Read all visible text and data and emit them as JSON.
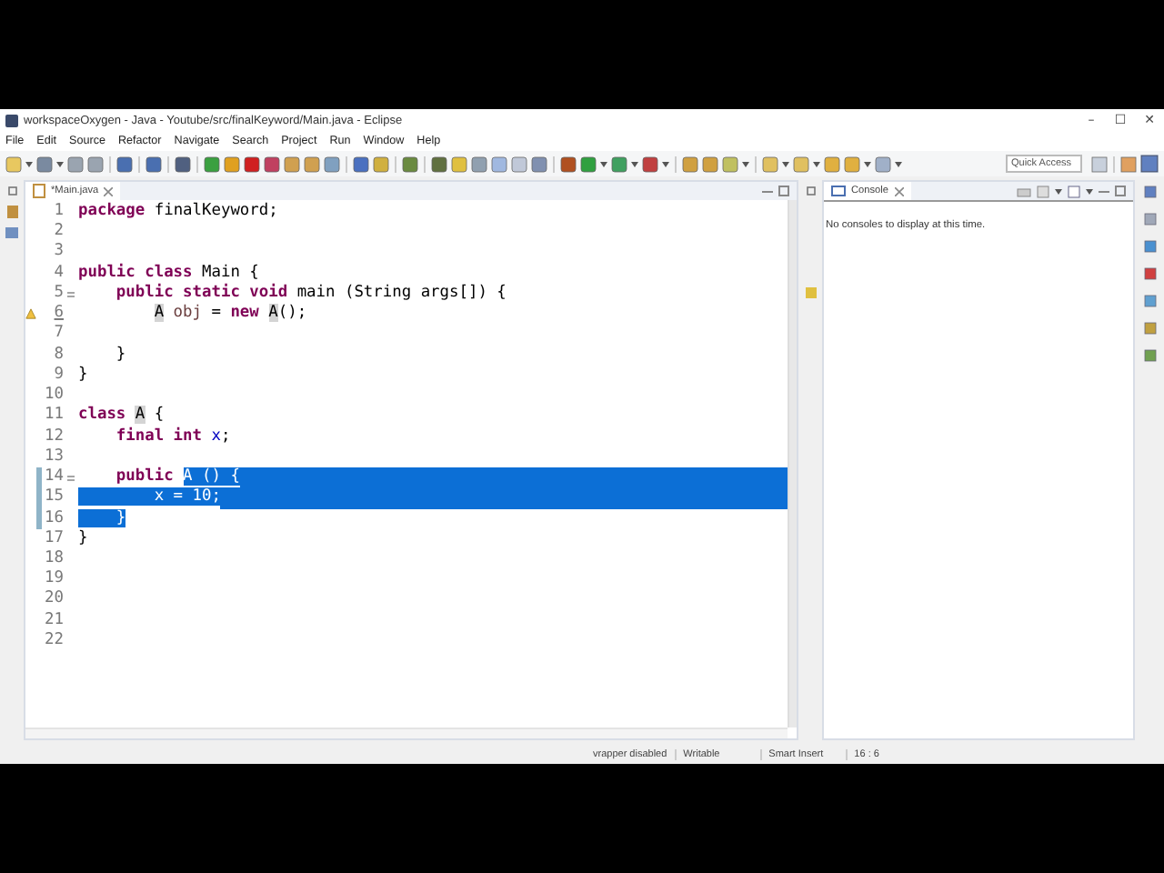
{
  "window": {
    "title": "workspaceOxygen - Java - Youtube/src/finalKeyword/Main.java - Eclipse",
    "controls": [
      "–",
      "☐",
      "✕"
    ]
  },
  "menu": [
    "File",
    "Edit",
    "Source",
    "Refactor",
    "Navigate",
    "Search",
    "Project",
    "Run",
    "Window",
    "Help"
  ],
  "quick_access": {
    "placeholder": "Quick Access"
  },
  "editor": {
    "tab": {
      "label": "*Main.java",
      "selected": true
    },
    "lines": [
      {
        "number": "1",
        "fold": false,
        "warning": false,
        "in_selection": false,
        "selected_to_end": false,
        "segments": [
          {
            "text": "package",
            "kind": "keyword",
            "selected": false
          },
          {
            "text": " finalKeyword;",
            "kind": "plain",
            "selected": false
          }
        ]
      },
      {
        "number": "2",
        "fold": false,
        "warning": false,
        "in_selection": false,
        "selected_to_end": false
      },
      {
        "number": "3",
        "fold": false,
        "warning": false,
        "in_selection": false,
        "selected_to_end": false
      },
      {
        "number": "4",
        "fold": false,
        "warning": false,
        "in_selection": false,
        "selected_to_end": false,
        "segments": [
          {
            "text": "public",
            "kind": "keyword",
            "selected": false
          },
          {
            "text": " class",
            "kind": "keyword",
            "selected": false
          },
          {
            "text": " Main {",
            "kind": "plain",
            "selected": false
          }
        ]
      },
      {
        "number": "5",
        "fold": true,
        "warning": false,
        "in_selection": false,
        "selected_to_end": false,
        "segments": [
          {
            "text": "    public",
            "kind": "keyword",
            "selected": false
          },
          {
            "text": " static",
            "kind": "keyword",
            "selected": false
          },
          {
            "text": " void",
            "kind": "keyword",
            "selected": false
          },
          {
            "text": " main (String args[]) {",
            "kind": "plain",
            "selected": false
          }
        ]
      },
      {
        "number": "6",
        "fold": false,
        "warning": true,
        "in_selection": false,
        "selected_to_end": false,
        "segments": [
          {
            "text": "        A",
            "kind": "occurrence",
            "selected": false
          },
          {
            "text": " obj",
            "kind": "local",
            "selected": false
          },
          {
            "text": " =",
            "kind": "plain",
            "selected": false
          },
          {
            "text": " new",
            "kind": "keyword",
            "selected": false
          },
          {
            "text": " A",
            "kind": "occurrence",
            "selected": false
          },
          {
            "text": "();",
            "kind": "plain",
            "selected": false
          }
        ]
      },
      {
        "number": "7",
        "fold": false,
        "warning": false,
        "in_selection": false,
        "selected_to_end": false
      },
      {
        "number": "8",
        "fold": false,
        "warning": false,
        "in_selection": false,
        "selected_to_end": false,
        "segments": [
          {
            "text": "    }",
            "kind": "plain",
            "selected": false
          }
        ]
      },
      {
        "number": "9",
        "fold": false,
        "warning": false,
        "in_selection": false,
        "selected_to_end": false,
        "segments": [
          {
            "text": "}",
            "kind": "plain",
            "selected": false
          }
        ]
      },
      {
        "number": "10",
        "fold": false,
        "warning": false,
        "in_selection": false,
        "selected_to_end": false
      },
      {
        "number": "11",
        "fold": false,
        "warning": false,
        "in_selection": false,
        "selected_to_end": false,
        "segments": [
          {
            "text": "class",
            "kind": "keyword",
            "selected": false
          },
          {
            "text": " A",
            "kind": "occurrence",
            "selected": false
          },
          {
            "text": " {",
            "kind": "plain",
            "selected": false
          }
        ]
      },
      {
        "number": "12",
        "fold": false,
        "warning": false,
        "in_selection": false,
        "selected_to_end": false,
        "segments": [
          {
            "text": "    final",
            "kind": "keyword",
            "selected": false
          },
          {
            "text": " int",
            "kind": "keyword",
            "selected": false
          },
          {
            "text": " x",
            "kind": "field",
            "selected": false
          },
          {
            "text": ";",
            "kind": "plain",
            "selected": false
          }
        ]
      },
      {
        "number": "13",
        "fold": false,
        "warning": false,
        "in_selection": false,
        "selected_to_end": false
      },
      {
        "number": "14",
        "fold": true,
        "warning": false,
        "in_selection": true,
        "selected_to_end": true,
        "segments": [
          {
            "text": "    public ",
            "kind": "keyword",
            "selected": false
          },
          {
            "text": "A () {",
            "kind": "plain",
            "selected": true
          }
        ]
      },
      {
        "number": "15",
        "fold": false,
        "warning": false,
        "in_selection": true,
        "selected_to_end": true,
        "segments": [
          {
            "text": "        x = 10;",
            "kind": "plain",
            "selected": true
          }
        ]
      },
      {
        "number": "16",
        "fold": false,
        "warning": false,
        "in_selection": true,
        "selected_to_end": false,
        "segments": [
          {
            "text": "    }",
            "kind": "plain",
            "selected": true
          }
        ]
      },
      {
        "number": "17",
        "fold": false,
        "warning": false,
        "in_selection": false,
        "selected_to_end": false,
        "segments": [
          {
            "text": "}",
            "kind": "plain",
            "selected": false
          }
        ]
      },
      {
        "number": "18",
        "fold": false,
        "warning": false,
        "in_selection": false,
        "selected_to_end": false
      },
      {
        "number": "19",
        "fold": false,
        "warning": false,
        "in_selection": false,
        "selected_to_end": false
      },
      {
        "number": "20",
        "fold": false,
        "warning": false,
        "in_selection": false,
        "selected_to_end": false
      },
      {
        "number": "21",
        "fold": false,
        "warning": false,
        "in_selection": false,
        "selected_to_end": false
      },
      {
        "number": "22",
        "fold": false,
        "warning": false,
        "in_selection": false,
        "selected_to_end": false
      }
    ]
  },
  "console": {
    "tab": {
      "label": "Console",
      "selected": true
    },
    "message": "No consoles to display at this time."
  },
  "status_bar": [
    "vrapper disabled",
    "Writable",
    "Smart Insert",
    "16 : 6"
  ]
}
